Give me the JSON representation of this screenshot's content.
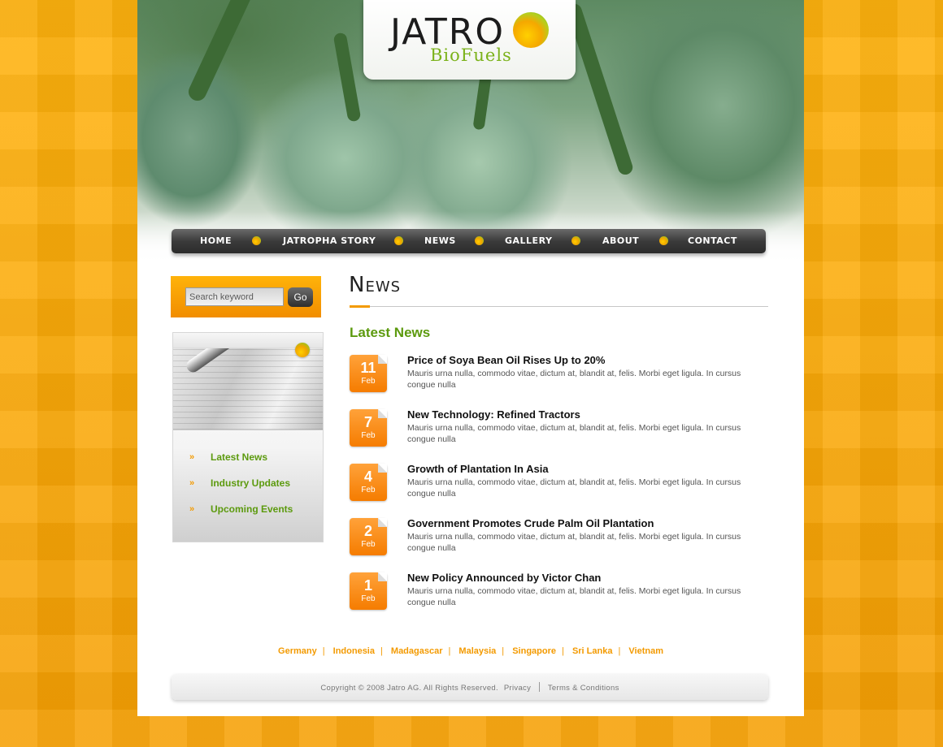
{
  "brand": {
    "name": "JATRO",
    "subtitle": "BioFuels"
  },
  "nav": {
    "items": [
      {
        "label": "Home"
      },
      {
        "label": "Jatropha Story"
      },
      {
        "label": "News"
      },
      {
        "label": "Gallery"
      },
      {
        "label": "About"
      },
      {
        "label": "Contact"
      }
    ]
  },
  "search": {
    "placeholder": "Search keyword",
    "button": "Go"
  },
  "sidebar": {
    "links": [
      {
        "label": "Latest News"
      },
      {
        "label": "Industry Updates"
      },
      {
        "label": "Upcoming Events"
      }
    ]
  },
  "main": {
    "title": "News",
    "section_heading": "Latest News",
    "news": [
      {
        "day": "11",
        "month": "Feb",
        "title": "Price of Soya Bean Oil Rises Up to 20%",
        "summary": "Mauris urna nulla, commodo vitae, dictum at, blandit at, felis. Morbi eget ligula. In cursus congue nulla"
      },
      {
        "day": "7",
        "month": "Feb",
        "title": "New Technology: Refined Tractors",
        "summary": "Mauris urna nulla, commodo vitae, dictum at, blandit at, felis. Morbi eget ligula. In cursus congue nulla"
      },
      {
        "day": "4",
        "month": "Feb",
        "title": "Growth of Plantation In Asia",
        "summary": "Mauris urna nulla, commodo vitae, dictum at, blandit at, felis. Morbi eget ligula. In cursus congue nulla"
      },
      {
        "day": "2",
        "month": "Feb",
        "title": "Government Promotes Crude Palm Oil Plantation",
        "summary": "Mauris urna nulla, commodo vitae, dictum at, blandit at, felis. Morbi eget ligula. In cursus congue nulla"
      },
      {
        "day": "1",
        "month": "Feb",
        "title": "New Policy Announced by Victor Chan",
        "summary": "Mauris urna nulla, commodo vitae, dictum at, blandit at, felis. Morbi eget ligula. In cursus congue nulla"
      }
    ]
  },
  "footer": {
    "countries": [
      "Germany",
      "Indonesia",
      "Madagascar",
      "Malaysia",
      "Singapore",
      "Sri Lanka",
      "Vietnam"
    ],
    "copyright": "Copyright © 2008 Jatro AG. All Rights Reserved.",
    "privacy": "Privacy",
    "terms": "Terms & Conditions"
  },
  "colors": {
    "accent_orange": "#f39a00",
    "accent_green": "#5c9a0e",
    "nav_dark": "#2c2c2c"
  },
  "icons": [
    "logo-ball-icon",
    "nav-separator-dot-icon",
    "arrow-bullet-icon",
    "pen-image"
  ]
}
